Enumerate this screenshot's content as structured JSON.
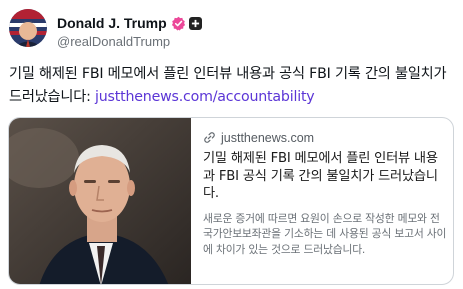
{
  "author": {
    "name": "Donald J. Trump",
    "handle": "@realDonaldTrump"
  },
  "post": {
    "text": "기밀 해제된 FBI 메모에서 플린 인터뷰 내용과 공식 FBI 기록 간의 불일치가 드러났습니다: ",
    "link": "justthenews.com/accountability"
  },
  "card": {
    "domain": "justthenews.com",
    "title": "기밀 해제된 FBI 메모에서 플린 인터뷰 내용과 FBI 공식 기록 간의 불일치가 드러났습니다.",
    "description": "새로운 증거에 따르면 요원이 손으로 작성한 메모와 전 국가안보보좌관을 기소하는 데 사용된 공식 보고서 사이에 차이가 있는 것으로 드러났습니다."
  },
  "colors": {
    "link": "#5b35d6",
    "verified_badge": "#ec4899"
  },
  "icons": {
    "verified": "verified-badge-icon",
    "square": "platform-badge-icon",
    "link": "link-icon"
  }
}
